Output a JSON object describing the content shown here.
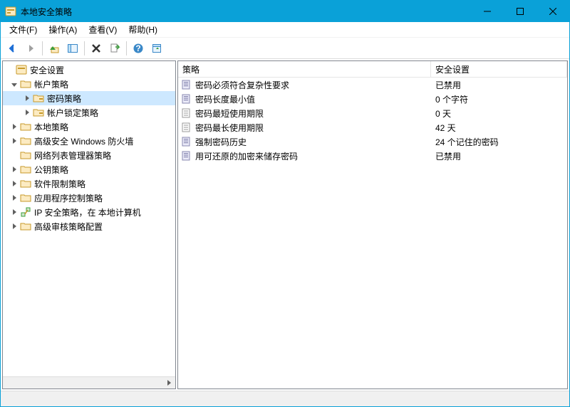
{
  "window": {
    "title": "本地安全策略"
  },
  "menubar": {
    "file": "文件(F)",
    "action": "操作(A)",
    "view": "查看(V)",
    "help": "帮助(H)"
  },
  "tree": {
    "root": "安全设置",
    "items": [
      {
        "label": "帐户策略",
        "children": [
          {
            "label": "密码策略"
          },
          {
            "label": "帐户锁定策略"
          }
        ]
      },
      {
        "label": "本地策略"
      },
      {
        "label": "高级安全 Windows 防火墙"
      },
      {
        "label": "网络列表管理器策略"
      },
      {
        "label": "公钥策略"
      },
      {
        "label": "软件限制策略"
      },
      {
        "label": "应用程序控制策略"
      },
      {
        "label": "IP 安全策略，在 本地计算机"
      },
      {
        "label": "高级审核策略配置"
      }
    ]
  },
  "list": {
    "columns": {
      "c1": "策略",
      "c2": "安全设置"
    },
    "rows": [
      {
        "name": "密码必须符合复杂性要求",
        "value": "已禁用"
      },
      {
        "name": "密码长度最小值",
        "value": "0 个字符"
      },
      {
        "name": "密码最短使用期限",
        "value": "0 天"
      },
      {
        "name": "密码最长使用期限",
        "value": "42 天"
      },
      {
        "name": "强制密码历史",
        "value": "24 个记住的密码"
      },
      {
        "name": "用可还原的加密来储存密码",
        "value": "已禁用"
      }
    ]
  }
}
